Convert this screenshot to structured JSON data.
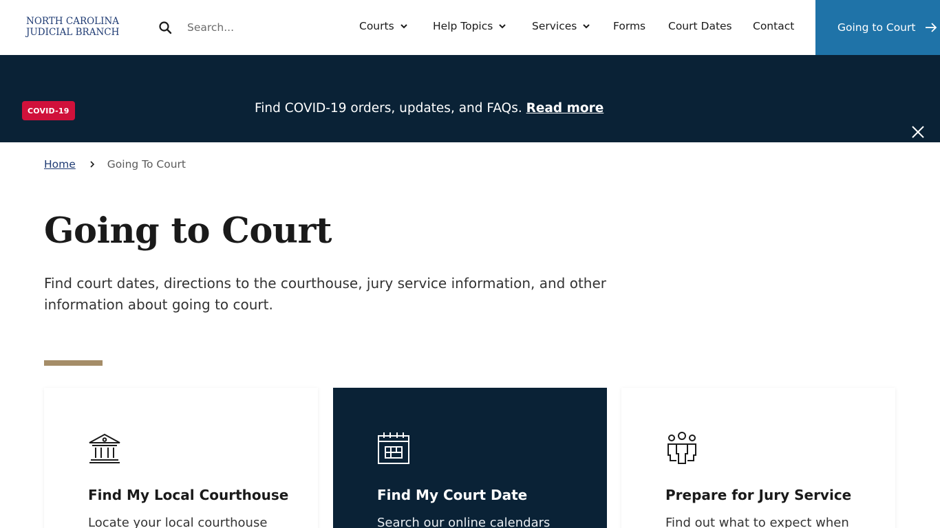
{
  "logo": {
    "line1": "NORTH CAROLINA",
    "line2": "JUDICIAL BRANCH"
  },
  "search": {
    "placeholder": "Search..."
  },
  "nav": {
    "items": [
      {
        "label": "Courts",
        "has_dropdown": true
      },
      {
        "label": "Help Topics",
        "has_dropdown": true
      },
      {
        "label": "Services",
        "has_dropdown": true
      },
      {
        "label": "Forms",
        "has_dropdown": false
      },
      {
        "label": "Court Dates",
        "has_dropdown": false
      },
      {
        "label": "Contact",
        "has_dropdown": false
      }
    ],
    "cta": "Going to Court"
  },
  "alert": {
    "badge": "COVID-19",
    "text": "Find COVID-19 orders, updates, and FAQs.",
    "link": "Read more"
  },
  "breadcrumb": {
    "home": "Home",
    "current": "Going To Court"
  },
  "page": {
    "title": "Going to Court",
    "intro": "Find court dates, directions to the courthouse, jury service information, and other information about going to court."
  },
  "cards": [
    {
      "title": "Find My Local Courthouse",
      "desc": "Locate your local courthouse",
      "icon": "courthouse-icon"
    },
    {
      "title": "Find My Court Date",
      "desc": "Search our online calendars",
      "icon": "calendar-icon"
    },
    {
      "title": "Prepare for Jury Service",
      "desc": "Find out what to expect when",
      "icon": "people-icon"
    }
  ],
  "colors": {
    "brand_navy": "#1f3b73",
    "cta_blue": "#1f73a8",
    "banner_bg": "#0a2236",
    "badge_red": "#d0113b",
    "accent_gold": "#a58d68"
  }
}
